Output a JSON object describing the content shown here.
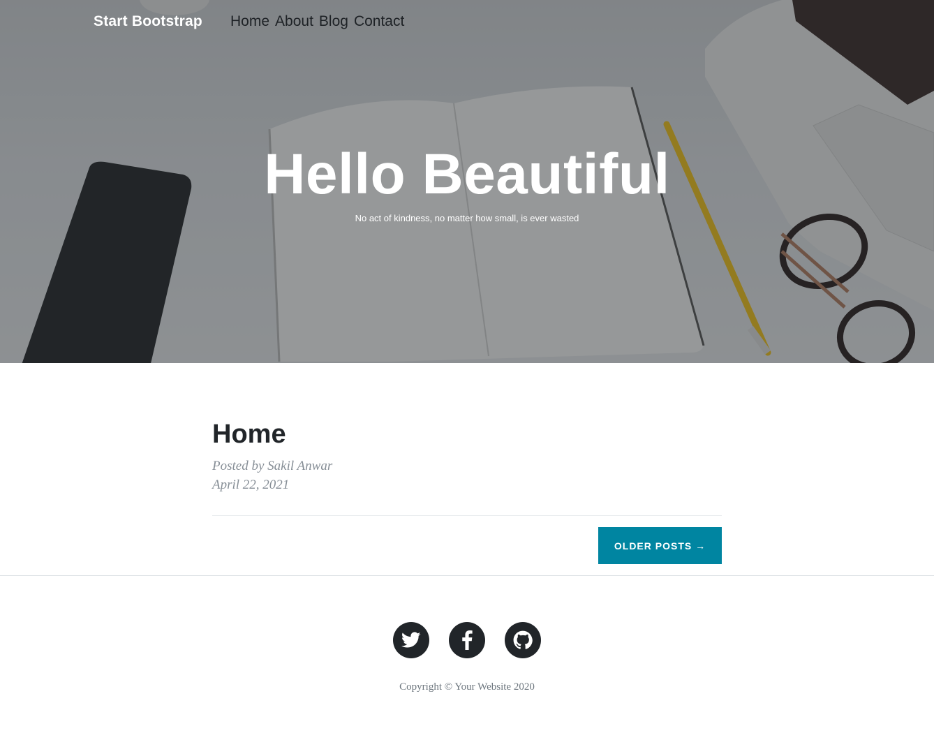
{
  "nav": {
    "brand": "Start Bootstrap",
    "links": [
      "Home",
      "About",
      "Blog",
      "Contact"
    ]
  },
  "hero": {
    "title": "Hello Beautiful",
    "subtitle": "No act of kindness, no matter how small, is ever wasted"
  },
  "post": {
    "title": "Home",
    "author_line": "Posted by Sakil Anwar",
    "date": "April 22, 2021"
  },
  "pager": {
    "older_label": "OLDER POSTS →"
  },
  "footer": {
    "social_icons": [
      "twitter-icon",
      "facebook-icon",
      "github-icon"
    ],
    "copyright": "Copyright © Your Website 2020"
  },
  "colors": {
    "accent": "#0085a1",
    "heading": "#212529",
    "meta": "#868e96"
  }
}
